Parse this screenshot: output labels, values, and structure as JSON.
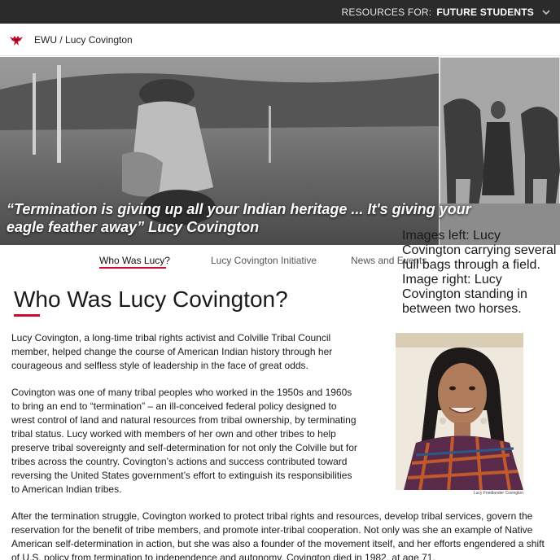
{
  "topbar": {
    "prefix": "RESOURCES FOR:",
    "audience": "FUTURE STUDENTS",
    "chevron_icon": "chevron-down-icon"
  },
  "breadcrumb": {
    "logo_icon": "eagle-logo-icon",
    "root": "EWU",
    "separator": " / ",
    "current": "Lucy Covington"
  },
  "hero": {
    "quote": "“Termination is giving up all your Indian heritage ... It's giving your eagle feather away” Lucy Covington",
    "caption": "Images left: Lucy Covington carrying several full bags through a field. Image right: Lucy Covington standing in between two horses."
  },
  "tabs": [
    {
      "label": "Who Was Lucy?",
      "active": true
    },
    {
      "label": "Lucy Covington Initiative",
      "active": false
    },
    {
      "label": "News and Events",
      "active": false
    }
  ],
  "content": {
    "title": "Who Was Lucy Covington?",
    "paragraphs": [
      "Lucy Covington, a long-time tribal rights activist and Colville Tribal Council member, helped change the course of American Indian history through her courageous and selfless style of leadership in the face of great odds.",
      "Covington was one of many tribal peoples who worked in the 1950s and 1960s to bring an end to “termination” – an ill-conceived federal policy designed to wrest control of land and natural resources from tribal ownership, by terminating tribal status. Lucy worked with members of her own and other tribes to help preserve tribal sovereignty and self-determination for not only the Colville but for tribes across the country. Covington’s actions and success contributed toward reversing the United States government’s effort to extinguish its responsibilities to American Indian tribes.",
      "After the termination struggle, Covington worked to protect tribal rights and resources, develop tribal services, govern the reservation for the benefit of tribe members, and promote inter-tribal cooperation. Not only was she an example of Native American self-determination in action, but she was also a founder of the movement itself, and her efforts engendered a shift of U.S. policy from termination to independence and autonomy. Covington died in 1982, at age 71."
    ],
    "portrait_caption": "Lucy Friedlander Covington"
  },
  "colors": {
    "accent": "#c8102e",
    "topbar_bg": "#2b2b2b"
  }
}
